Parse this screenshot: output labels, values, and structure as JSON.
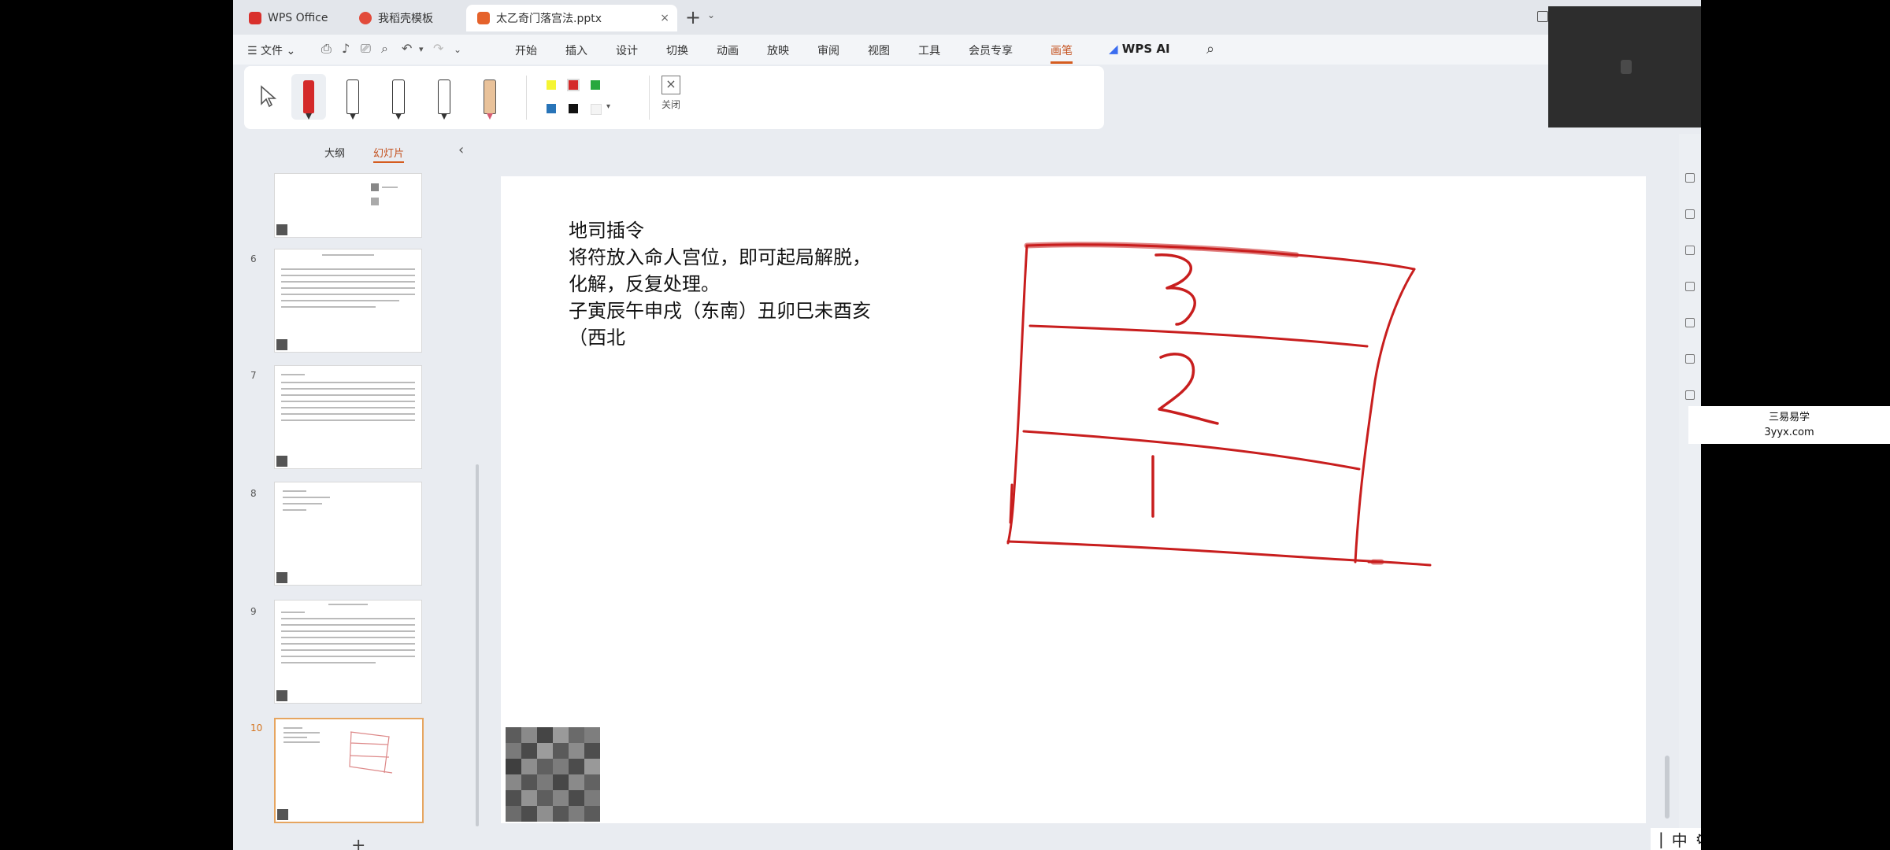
{
  "tabs": [
    {
      "label": "WPS Office",
      "active": false
    },
    {
      "label": "我稻壳模板",
      "active": false
    },
    {
      "label": "太乙奇门落宫法.pptx",
      "active": true
    }
  ],
  "menu": {
    "file": "文件",
    "items": [
      "开始",
      "插入",
      "设计",
      "切换",
      "动画",
      "放映",
      "审阅",
      "视图",
      "工具",
      "会员专享",
      "画笔"
    ],
    "active": "画笔",
    "ai": "WPS AI"
  },
  "pen_toolbar": {
    "close_label": "关闭",
    "colors": [
      "#f5f533",
      "#d42a2a",
      "#27a83e",
      "#2874b8",
      "#111111",
      "#f4f4f4"
    ]
  },
  "panel": {
    "tab_outline": "大纲",
    "tab_slides": "幻灯片",
    "slide_numbers": [
      "6",
      "7",
      "8",
      "9",
      "10"
    ],
    "add": "+"
  },
  "slide": {
    "lines": [
      "地司插令",
      "将符放入命人宫位，即可起局解脱，",
      "化解，反复处理。",
      "子寅辰午申戌（东南）丑卯巳未酉亥",
      "（西北"
    ],
    "handwritten_digits": [
      "3",
      "2",
      "1"
    ],
    "ink_color": "#c81e1e"
  },
  "status": {
    "ime": "中"
  },
  "watermark": {
    "line1": "三易易学",
    "line2": "3yyx.com"
  }
}
